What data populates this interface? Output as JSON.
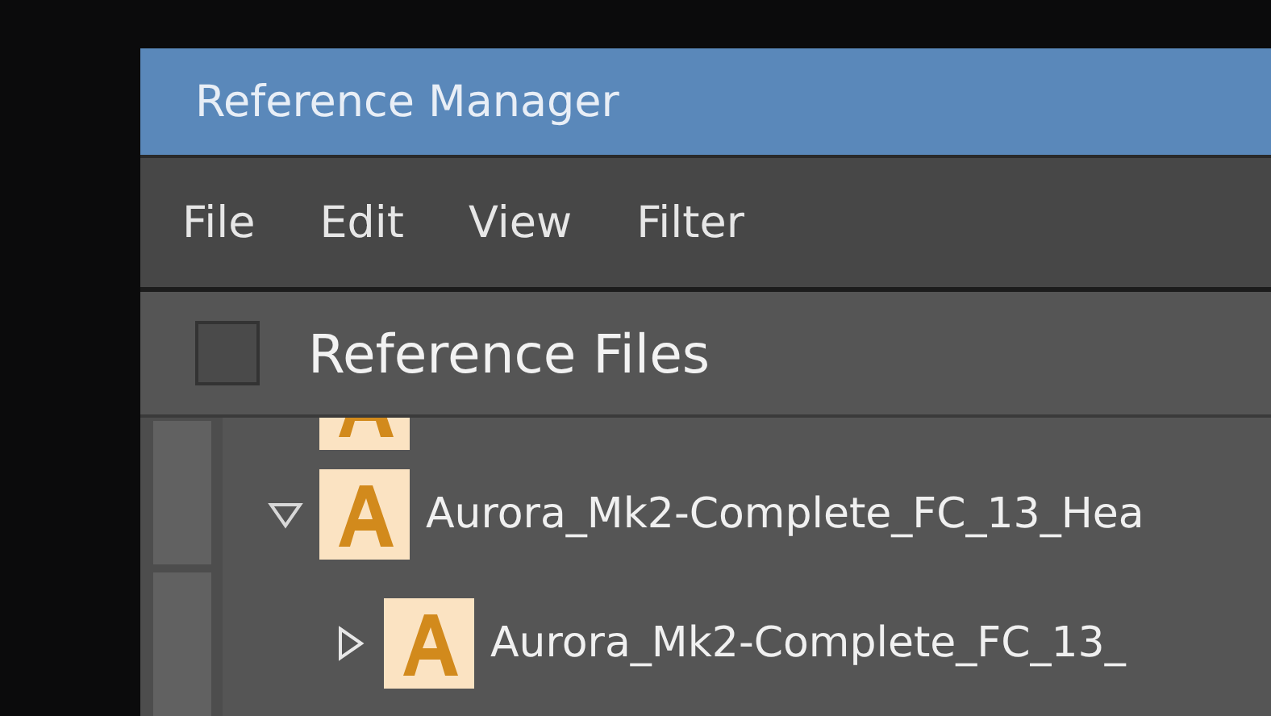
{
  "window": {
    "title": "Reference Manager"
  },
  "menu": [
    "File",
    "Edit",
    "View",
    "Filter"
  ],
  "header": {
    "checked": false,
    "title": "Reference Files"
  },
  "tree": [
    {
      "kind": "partial"
    },
    {
      "kind": "file",
      "label": "Aurora_Mk2-Complete_FC_13_Hea",
      "expanded": true,
      "children": [
        {
          "kind": "file",
          "label": "Aurora_Mk2-Complete_FC_13_",
          "expanded": false
        }
      ]
    }
  ]
}
